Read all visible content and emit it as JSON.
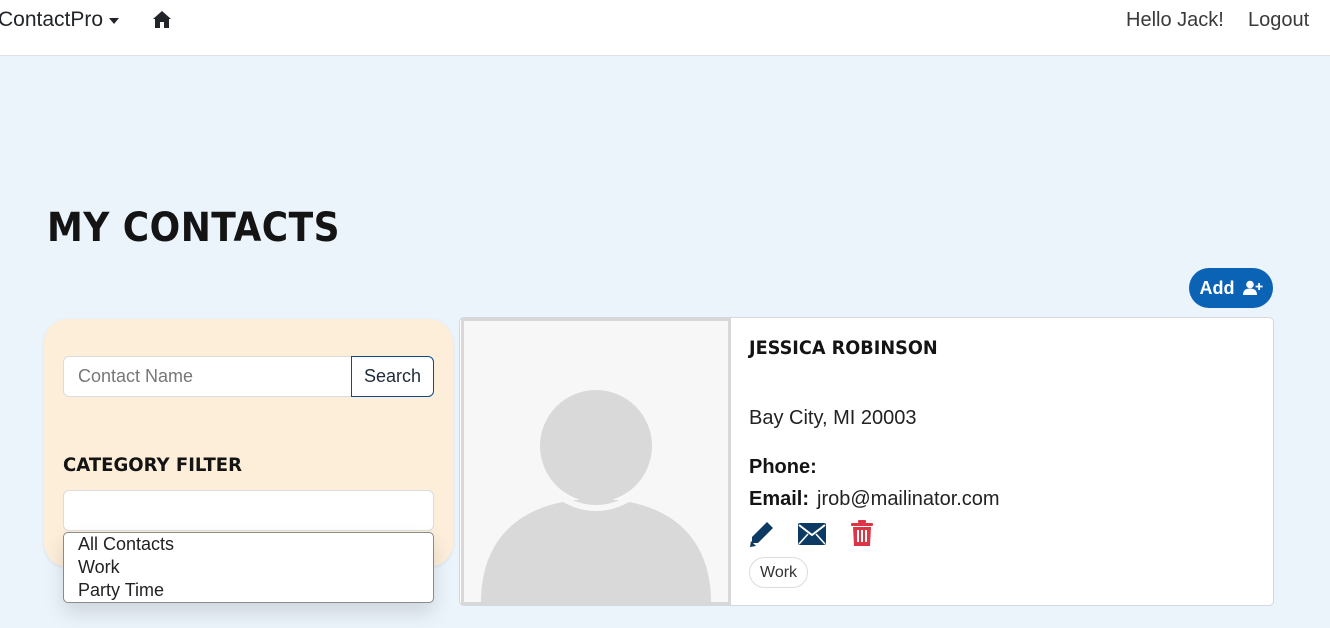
{
  "navbar": {
    "brand": "ContactPro",
    "greeting": "Hello Jack!",
    "logout": "Logout"
  },
  "page": {
    "title": "MY CONTACTS",
    "add_label": "Add"
  },
  "filter": {
    "search_placeholder": "Contact Name",
    "search_button": "Search",
    "heading": "CATEGORY FILTER",
    "options": [
      "All Contacts",
      "Work",
      "Party Time"
    ]
  },
  "contact": {
    "name": "JESSICA ROBINSON",
    "address": "Bay City, MI 20003",
    "phone_label": "Phone:",
    "phone": "",
    "email_label": "Email:",
    "email": "jrob@mailinator.com",
    "category": "Work"
  },
  "colors": {
    "primary": "#0b63b6",
    "page_bg": "#ebf3fb",
    "panel_bg": "#fdeeda",
    "danger": "#dc3545",
    "icon_dark": "#0d3a63"
  },
  "icons": {
    "home": "home-icon",
    "add": "user-plus-icon",
    "edit": "pencil-icon",
    "email": "envelope-icon",
    "delete": "trash-icon"
  }
}
